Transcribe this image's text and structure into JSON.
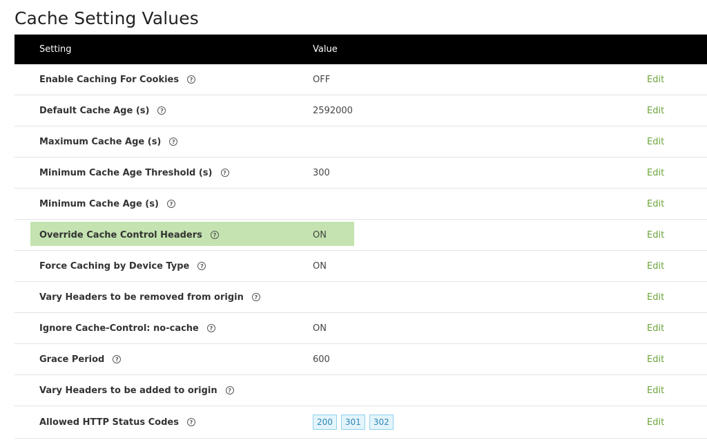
{
  "page": {
    "title": "Cache Setting Values"
  },
  "table": {
    "headers": {
      "setting": "Setting",
      "value": "Value"
    },
    "edit_label": "Edit",
    "rows": [
      {
        "label": "Enable Caching For Cookies",
        "value": "OFF"
      },
      {
        "label": "Default Cache Age (s)",
        "value": "2592000"
      },
      {
        "label": "Maximum Cache Age (s)",
        "value": ""
      },
      {
        "label": "Minimum Cache Age Threshold (s)",
        "value": "300"
      },
      {
        "label": "Minimum Cache Age (s)",
        "value": ""
      },
      {
        "label": "Override Cache Control Headers",
        "value": "ON",
        "highlighted": true
      },
      {
        "label": "Force Caching by Device Type",
        "value": "ON"
      },
      {
        "label": "Vary Headers to be removed from origin",
        "value": ""
      },
      {
        "label": "Ignore Cache-Control: no-cache",
        "value": "ON"
      },
      {
        "label": "Grace Period",
        "value": "600"
      },
      {
        "label": "Vary Headers to be added to origin",
        "value": ""
      },
      {
        "label": "Allowed HTTP Status Codes",
        "value": "",
        "codes": [
          "200",
          "301",
          "302"
        ]
      }
    ]
  },
  "icons": {
    "help": "question-circle-icon",
    "help_glyph": "?"
  },
  "colors": {
    "header_bg": "#000000",
    "highlight": "#c4e3b0",
    "edit_link": "#6ba43a",
    "badge_bg": "#e3f4fb",
    "badge_border": "#8fd0ec"
  }
}
